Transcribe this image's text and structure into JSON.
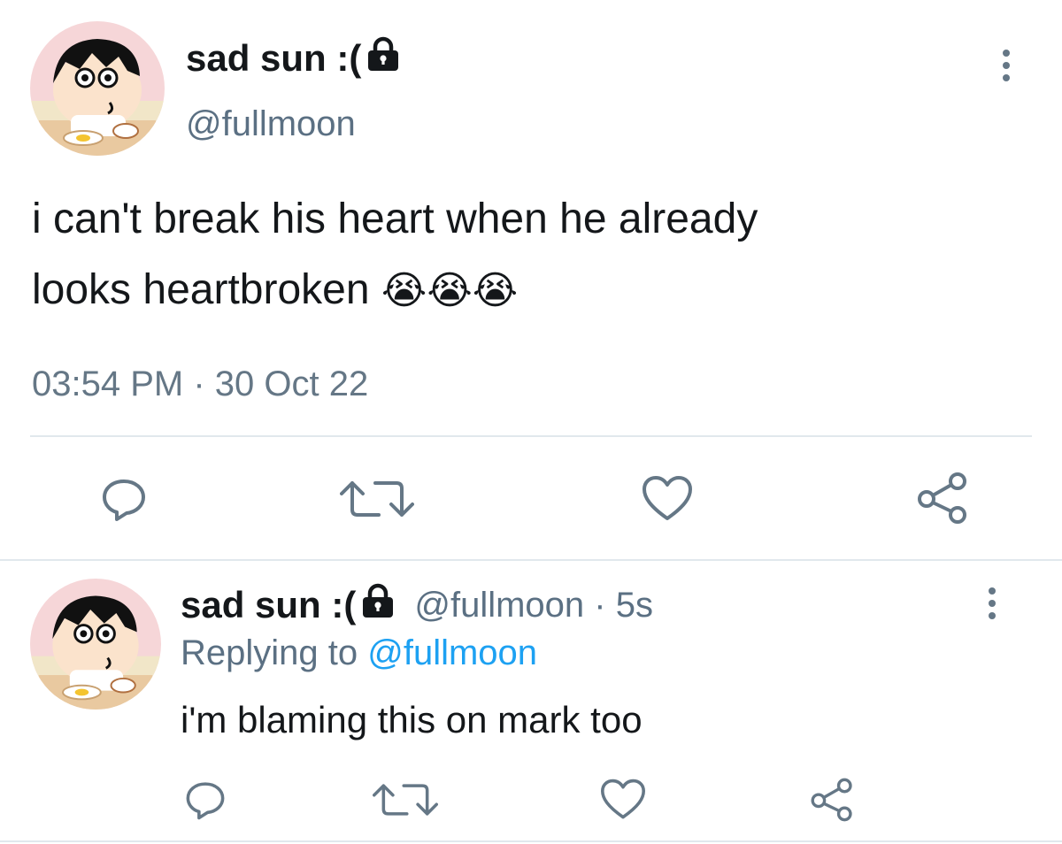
{
  "main_tweet": {
    "display_name": "sad sun :(",
    "handle": "@fullmoon",
    "text_line1": "i can't break his heart when he already",
    "text_line2": "looks heartbroken",
    "emoji": "😭😭😭",
    "timestamp": "03:54 PM · 30 Oct 22"
  },
  "reply_tweet": {
    "display_name": "sad sun :(",
    "handle_time": "@fullmoon · 5s",
    "replying_prefix": "Replying to",
    "replying_handle": "@fullmoon",
    "text": "i'm blaming this on mark too"
  },
  "icons": {
    "reply": "reply-icon",
    "retweet": "retweet-icon",
    "like": "heart-icon",
    "share": "share-icon",
    "lock": "lock-icon",
    "more": "more-vertical-icon"
  },
  "colors": {
    "text": "#14171a",
    "secondary": "#5b7083",
    "icon": "#657786",
    "link": "#1da1f2",
    "divider": "#e1e8ed"
  }
}
